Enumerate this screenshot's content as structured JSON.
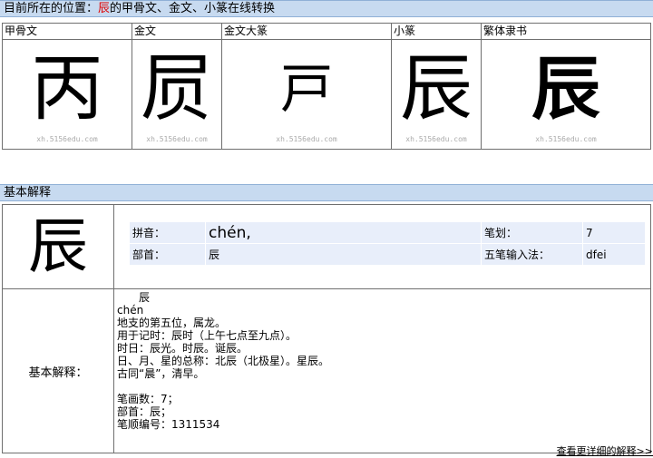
{
  "location_bar": {
    "prefix": "目前所在的位置：",
    "char": "辰",
    "suffix": "的甲骨文、金文、小篆在线转换"
  },
  "font_styles": [
    {
      "label": "甲骨文",
      "glyph": "丙",
      "watermark": "xh.5156edu.com"
    },
    {
      "label": "金文",
      "glyph": "屃",
      "watermark": "xh.5156edu.com"
    },
    {
      "label": "金文大篆",
      "glyph": "戸",
      "watermark": "xh.5156edu.com"
    },
    {
      "label": "小篆",
      "glyph": "辰",
      "watermark": "xh.5156edu.com"
    },
    {
      "label": "繁体隶书",
      "glyph": "辰",
      "watermark": "xh.5156edu.com"
    }
  ],
  "basic_bar": {
    "title": "基本解释"
  },
  "character": "辰",
  "info": {
    "pinyin_label": "拼音：",
    "pinyin": "chén,",
    "strokes_label": "笔划：",
    "strokes": "7",
    "radical_label": "部首：",
    "radical": "辰",
    "wubi_label": "五笔输入法：",
    "wubi": "dfei"
  },
  "detail": {
    "label": "基本解释：",
    "lines": [
      "　　辰",
      "chén",
      "地支的第五位，属龙。",
      "用于记时：辰时（上午七点至九点）。",
      "时日：辰光。时辰。诞辰。",
      "日、月、星的总称：北辰（北极星）。星辰。",
      "古同“晨”，清早。",
      "",
      "笔画数：7；",
      "部首：辰；",
      "笔顺编号：1311534"
    ]
  },
  "more_link": "查看更详细的解释>>"
}
